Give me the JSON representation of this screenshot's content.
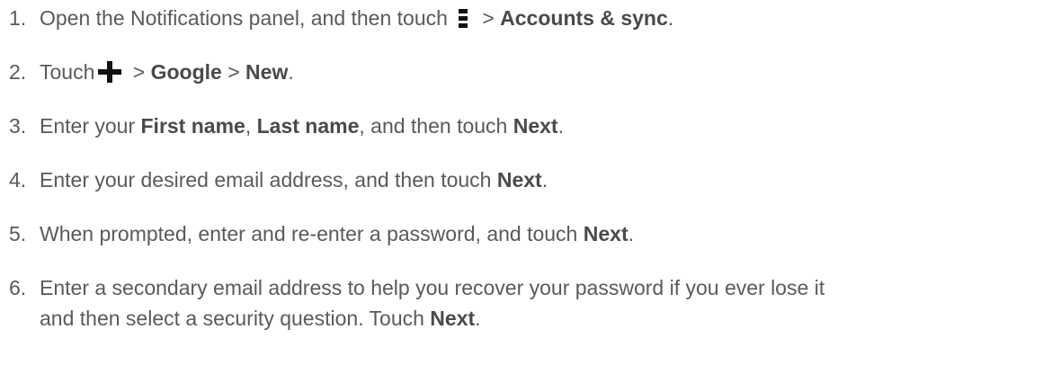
{
  "steps": [
    {
      "number": "1.",
      "t1": "Open the Notifications panel, and then touch",
      "icon": "menu-icon",
      "t2": " > ",
      "b1": "Accounts & sync",
      "t3": "."
    },
    {
      "number": "2.",
      "t1": "Touch",
      "icon": "plus-icon",
      "t2": " > ",
      "b1": "Google",
      "t3": " > ",
      "b2": "New",
      "t4": "."
    },
    {
      "number": "3.",
      "t1": "Enter your ",
      "b1": "First name",
      "t2": ", ",
      "b2": "Last name",
      "t3": ", and then touch ",
      "b3": "Next",
      "t4": "."
    },
    {
      "number": "4.",
      "t1": "Enter your desired email address, and then touch ",
      "b1": "Next",
      "t2": "."
    },
    {
      "number": "5.",
      "t1": "When prompted, enter and re-enter a password, and touch ",
      "b1": "Next",
      "t2": "."
    },
    {
      "number": "6.",
      "line1": "Enter a secondary email address to help you recover your password if you ever lose it",
      "t1": "and then select a security question. Touch ",
      "b1": "Next",
      "t2": "."
    }
  ]
}
